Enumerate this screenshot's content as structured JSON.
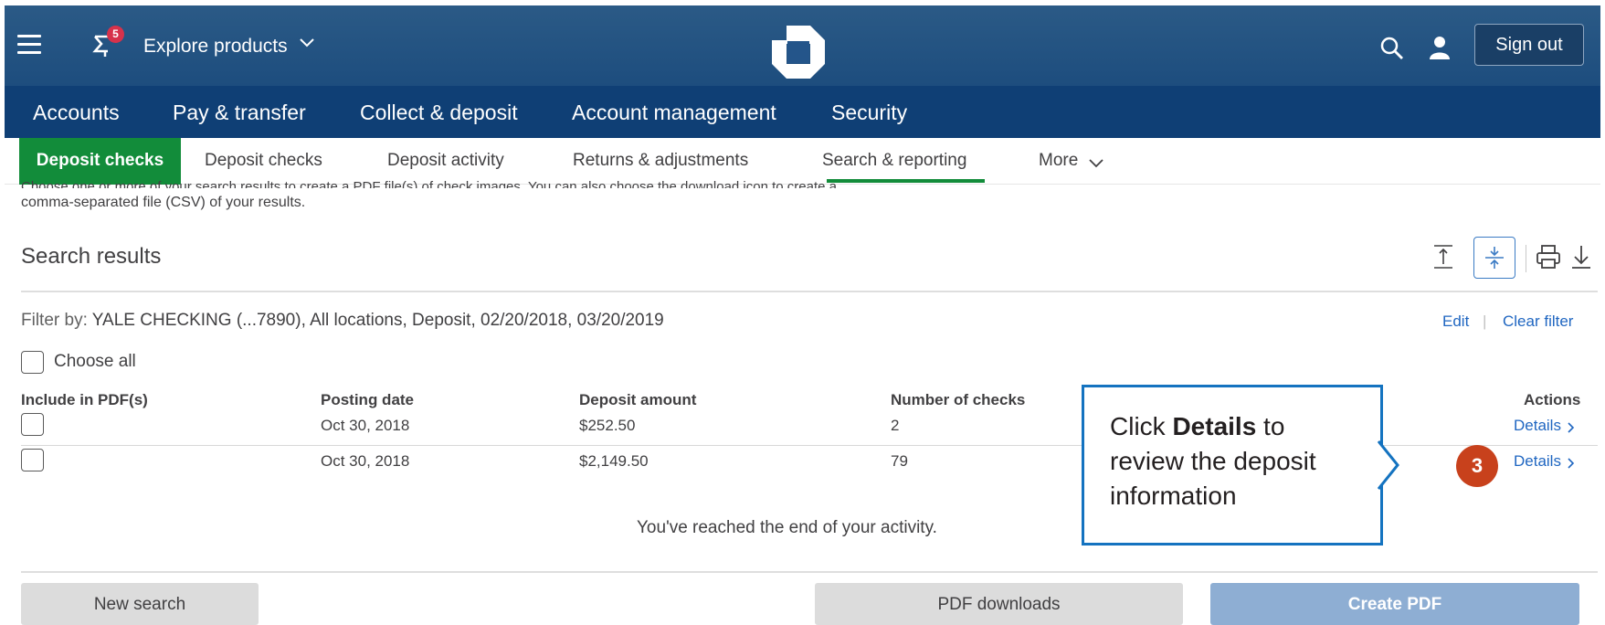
{
  "header": {
    "notification_count": "5",
    "explore_label": "Explore products",
    "signout_label": "Sign out"
  },
  "primary_nav": [
    "Accounts",
    "Pay & transfer",
    "Collect & deposit",
    "Account management",
    "Security"
  ],
  "sub_nav": {
    "active_section": "Deposit checks",
    "items": [
      "Deposit checks",
      "Deposit activity",
      "Returns & adjustments",
      "Search & reporting",
      "More"
    ]
  },
  "intro": {
    "line1": "Choose one or more of your search results to create a PDF file(s) of check images. You can also choose the download icon to create a",
    "line2": "comma-separated file (CSV) of your results."
  },
  "results": {
    "title": "Search results",
    "filter_label": "Filter by:",
    "filter_value": "YALE CHECKING (...7890), All locations, Deposit, 02/20/2018, 03/20/2019",
    "edit_label": "Edit",
    "divider": "|",
    "clear_label": "Clear filter",
    "choose_all_label": "Choose all",
    "columns": {
      "include": "Include in PDF(s)",
      "posting_date": "Posting date",
      "deposit_amount": "Deposit amount",
      "number_of_checks": "Number of checks",
      "actions": "Actions"
    },
    "rows": [
      {
        "posting_date": "Oct 30, 2018",
        "deposit_amount": "$252.50",
        "number_of_checks": "2",
        "action": "Details"
      },
      {
        "posting_date": "Oct 30, 2018",
        "deposit_amount": "$2,149.50",
        "number_of_checks": "79",
        "action": "Details"
      }
    ],
    "end_message": "You've reached the end of your activity."
  },
  "buttons": {
    "new_search": "New search",
    "pdf_downloads": "PDF downloads",
    "create_pdf": "Create PDF"
  },
  "callout": {
    "prefix": "Click ",
    "bold": "Details",
    "suffix": " to review the deposit information",
    "step": "3"
  }
}
